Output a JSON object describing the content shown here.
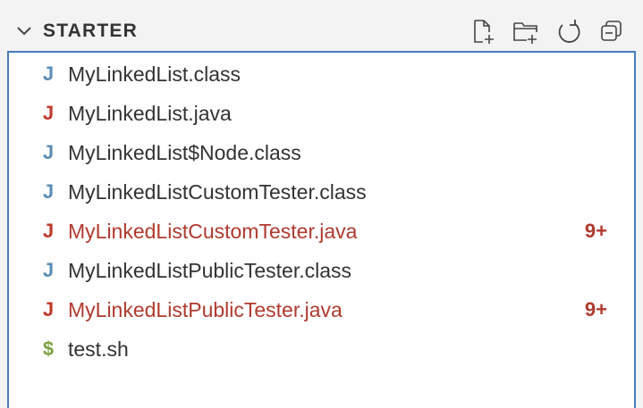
{
  "section": {
    "title": "STARTER",
    "actions": [
      {
        "name": "new-file-icon"
      },
      {
        "name": "new-folder-icon"
      },
      {
        "name": "refresh-icon"
      },
      {
        "name": "collapse-all-icon"
      }
    ]
  },
  "files": [
    {
      "icon": "J",
      "icon_color": "#5a8db5",
      "name": "MyLinkedList.class",
      "name_color": "#333333",
      "badge": ""
    },
    {
      "icon": "J",
      "icon_color": "#c0392b",
      "name": "MyLinkedList.java",
      "name_color": "#333333",
      "badge": ""
    },
    {
      "icon": "J",
      "icon_color": "#5a8db5",
      "name": "MyLinkedList$Node.class",
      "name_color": "#333333",
      "badge": ""
    },
    {
      "icon": "J",
      "icon_color": "#5a8db5",
      "name": "MyLinkedListCustomTester.class",
      "name_color": "#333333",
      "badge": ""
    },
    {
      "icon": "J",
      "icon_color": "#c0392b",
      "name": "MyLinkedListCustomTester.java",
      "name_color": "#b03a2e",
      "badge": "9+"
    },
    {
      "icon": "J",
      "icon_color": "#5a8db5",
      "name": "MyLinkedListPublicTester.class",
      "name_color": "#333333",
      "badge": ""
    },
    {
      "icon": "J",
      "icon_color": "#c0392b",
      "name": "MyLinkedListPublicTester.java",
      "name_color": "#b03a2e",
      "badge": "9+"
    },
    {
      "icon": "$",
      "icon_color": "#7ba23f",
      "name": "test.sh",
      "name_color": "#333333",
      "badge": ""
    }
  ]
}
